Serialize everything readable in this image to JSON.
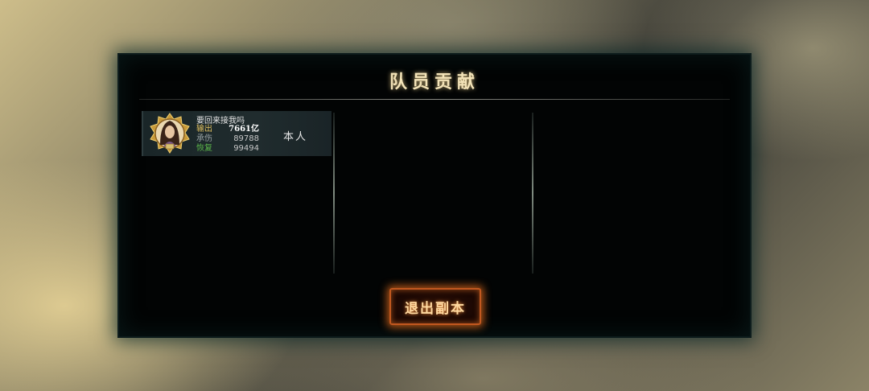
{
  "panel": {
    "title": "队员贡献"
  },
  "members": [
    {
      "name": "要回来接我吗",
      "stats": {
        "output_label": "输出",
        "output_value": "7661亿",
        "tank_label": "承伤",
        "tank_value": "89788",
        "heal_label": "恢复",
        "heal_value": "99494"
      },
      "tag": "本人"
    }
  ],
  "buttons": {
    "exit_label": "退出副本"
  },
  "colors": {
    "title": "#f3e3b8",
    "button_border": "#c2581f",
    "output_label": "#e0c060",
    "heal_label": "#5cb84a"
  },
  "icons": {
    "avatar": "hero-portrait-icon"
  }
}
